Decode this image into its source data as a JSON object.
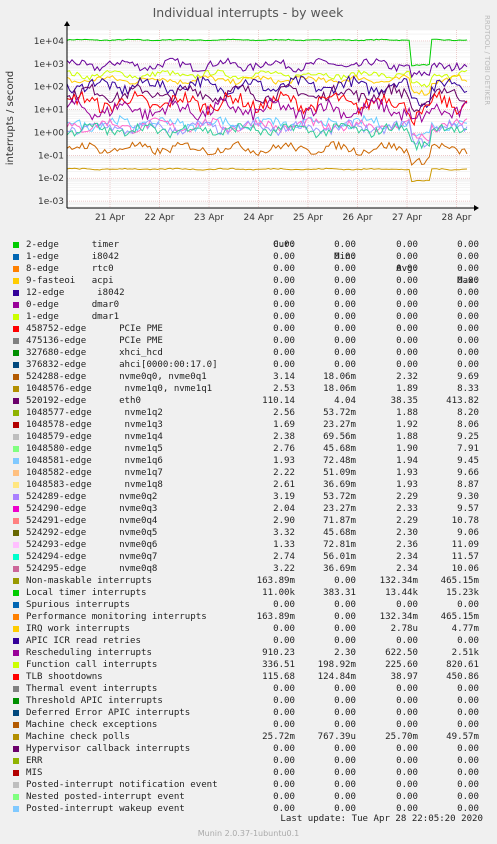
{
  "chart_data": {
    "type": "line",
    "title": "Individual interrupts - by week",
    "ylabel": "interrupts / second",
    "yscale": "log",
    "ylim": [
      0.0005,
      30000
    ],
    "y_ticks": [
      "1e+04",
      "1e+03",
      "1e+02",
      "1e+01",
      "1e+00",
      "1e-01",
      "1e-02",
      "1e-03"
    ],
    "x_ticks": [
      "21 Apr",
      "22 Apr",
      "23 Apr",
      "24 Apr",
      "25 Apr",
      "26 Apr",
      "27 Apr",
      "28 Apr"
    ],
    "side_label": "RRDTOOL / TOBI OETIKER",
    "grid": true,
    "series_profiles": [
      {
        "color": "#00cc00",
        "level": 11000,
        "spread": 0.04,
        "note": "Local timer interrupts"
      },
      {
        "color": "#660099",
        "level": 900,
        "spread": 0.35
      },
      {
        "color": "#ccff00",
        "level": 336,
        "spread": 0.25
      },
      {
        "color": "#ffcc00",
        "level": 200,
        "spread": 0.25
      },
      {
        "color": "#330099",
        "level": 110,
        "spread": 0.5
      },
      {
        "color": "#660066",
        "level": 50,
        "spread": 0.5
      },
      {
        "color": "#ff0000",
        "level": 20,
        "spread": 0.6
      },
      {
        "color": "#990099",
        "level": 10,
        "spread": 0.6
      },
      {
        "color": "#66ccff",
        "level": 2.5,
        "spread": 0.4
      },
      {
        "color": "#ff66cc",
        "level": 2.0,
        "spread": 0.4
      },
      {
        "color": "#9999ff",
        "level": 1.6,
        "spread": 0.4
      },
      {
        "color": "#33cc99",
        "level": 1.3,
        "spread": 0.4
      },
      {
        "color": "#cc6600",
        "level": 0.2,
        "spread": 0.35
      },
      {
        "color": "#cc9900",
        "level": 0.025,
        "spread": 0.05
      }
    ]
  },
  "legend": {
    "headers": {
      "cur": "Cur:",
      "min": "Min:",
      "avg": "Avg:",
      "max": "Max:"
    },
    "rows": [
      {
        "name": "2-edge      timer",
        "color": "#00cc00",
        "cur": "0.00",
        "min": "0.00",
        "avg": "0.00",
        "max": "0.00"
      },
      {
        "name": "1-edge      i8042",
        "color": "#0066b3",
        "cur": "0.00",
        "min": "0.00",
        "avg": "0.00",
        "max": "0.00"
      },
      {
        "name": "8-edge      rtc0",
        "color": "#ff8000",
        "cur": "0.00",
        "min": "0.00",
        "avg": "0.00",
        "max": "0.00"
      },
      {
        "name": "9-fasteoi   acpi",
        "color": "#ffcc00",
        "cur": "0.00",
        "min": "0.00",
        "avg": "0.00",
        "max": "0.00"
      },
      {
        "name": "12-edge      i8042",
        "color": "#330099",
        "cur": "0.00",
        "min": "0.00",
        "avg": "0.00",
        "max": "0.00"
      },
      {
        "name": "0-edge      dmar0",
        "color": "#990099",
        "cur": "0.00",
        "min": "0.00",
        "avg": "0.00",
        "max": "0.00"
      },
      {
        "name": "1-edge      dmar1",
        "color": "#ccff00",
        "cur": "0.00",
        "min": "0.00",
        "avg": "0.00",
        "max": "0.00"
      },
      {
        "name": "458752-edge      PCIe PME",
        "color": "#ff0000",
        "cur": "0.00",
        "min": "0.00",
        "avg": "0.00",
        "max": "0.00"
      },
      {
        "name": "475136-edge      PCIe PME",
        "color": "#808080",
        "cur": "0.00",
        "min": "0.00",
        "avg": "0.00",
        "max": "0.00"
      },
      {
        "name": "327680-edge      xhci_hcd",
        "color": "#008f00",
        "cur": "0.00",
        "min": "0.00",
        "avg": "0.00",
        "max": "0.00"
      },
      {
        "name": "376832-edge      ahci[0000:00:17.0]",
        "color": "#00487d",
        "cur": "0.00",
        "min": "0.00",
        "avg": "0.00",
        "max": "0.00"
      },
      {
        "name": "524288-edge      nvme0q0, nvme0q1",
        "color": "#b35a00",
        "cur": "3.14",
        "min": "18.06m",
        "avg": "2.32",
        "max": "9.69"
      },
      {
        "name": "1048576-edge      nvme1q0, nvme1q1",
        "color": "#b38f00",
        "cur": "2.53",
        "min": "18.06m",
        "avg": "1.89",
        "max": "8.33"
      },
      {
        "name": "520192-edge      eth0",
        "color": "#6b006b",
        "cur": "110.14",
        "min": "4.04",
        "avg": "38.35",
        "max": "413.82"
      },
      {
        "name": "1048577-edge      nvme1q2",
        "color": "#8fb300",
        "cur": "2.56",
        "min": "53.72m",
        "avg": "1.88",
        "max": "8.20"
      },
      {
        "name": "1048578-edge      nvme1q3",
        "color": "#b30000",
        "cur": "1.69",
        "min": "23.27m",
        "avg": "1.92",
        "max": "8.06"
      },
      {
        "name": "1048579-edge      nvme1q4",
        "color": "#bebebe",
        "cur": "2.38",
        "min": "69.56m",
        "avg": "1.88",
        "max": "9.25"
      },
      {
        "name": "1048580-edge      nvme1q5",
        "color": "#80ff80",
        "cur": "2.76",
        "min": "45.68m",
        "avg": "1.90",
        "max": "7.91"
      },
      {
        "name": "1048581-edge      nvme1q6",
        "color": "#80c9ff",
        "cur": "1.93",
        "min": "72.48m",
        "avg": "1.94",
        "max": "9.45"
      },
      {
        "name": "1048582-edge      nvme1q7",
        "color": "#ffc080",
        "cur": "2.22",
        "min": "51.09m",
        "avg": "1.93",
        "max": "9.66"
      },
      {
        "name": "1048583-edge      nvme1q8",
        "color": "#ffe680",
        "cur": "2.61",
        "min": "36.69m",
        "avg": "1.93",
        "max": "8.87"
      },
      {
        "name": "524289-edge      nvme0q2",
        "color": "#aa80ff",
        "cur": "3.19",
        "min": "53.72m",
        "avg": "2.29",
        "max": "9.30"
      },
      {
        "name": "524290-edge      nvme0q3",
        "color": "#ee00cc",
        "cur": "2.04",
        "min": "23.27m",
        "avg": "2.33",
        "max": "9.57"
      },
      {
        "name": "524291-edge      nvme0q4",
        "color": "#ff8080",
        "cur": "2.90",
        "min": "71.87m",
        "avg": "2.29",
        "max": "10.78"
      },
      {
        "name": "524292-edge      nvme0q5",
        "color": "#666600",
        "cur": "3.32",
        "min": "45.68m",
        "avg": "2.30",
        "max": "9.06"
      },
      {
        "name": "524293-edge      nvme0q6",
        "color": "#ffbfff",
        "cur": "1.33",
        "min": "72.81m",
        "avg": "2.36",
        "max": "11.09"
      },
      {
        "name": "524294-edge      nvme0q7",
        "color": "#00ffcc",
        "cur": "2.74",
        "min": "56.01m",
        "avg": "2.34",
        "max": "11.57"
      },
      {
        "name": "524295-edge      nvme0q8",
        "color": "#cc6699",
        "cur": "3.22",
        "min": "36.69m",
        "avg": "2.34",
        "max": "10.06"
      },
      {
        "name": "Non-maskable interrupts",
        "color": "#999900",
        "cur": "163.89m",
        "min": "0.00",
        "avg": "132.34m",
        "max": "465.15m"
      },
      {
        "name": "Local timer interrupts",
        "color": "#00cc00",
        "cur": "11.00k",
        "min": "383.31",
        "avg": "13.44k",
        "max": "15.23k"
      },
      {
        "name": "Spurious interrupts",
        "color": "#0066b3",
        "cur": "0.00",
        "min": "0.00",
        "avg": "0.00",
        "max": "0.00"
      },
      {
        "name": "Performance monitoring interrupts",
        "color": "#ff8000",
        "cur": "163.89m",
        "min": "0.00",
        "avg": "132.34m",
        "max": "465.15m"
      },
      {
        "name": "IRQ work interrupts",
        "color": "#ffcc00",
        "cur": "0.00",
        "min": "0.00",
        "avg": "2.78u",
        "max": "4.77m"
      },
      {
        "name": "APIC ICR read retries",
        "color": "#330099",
        "cur": "0.00",
        "min": "0.00",
        "avg": "0.00",
        "max": "0.00"
      },
      {
        "name": "Rescheduling interrupts",
        "color": "#990099",
        "cur": "910.23",
        "min": "2.30",
        "avg": "622.50",
        "max": "2.51k"
      },
      {
        "name": "Function call interrupts",
        "color": "#ccff00",
        "cur": "336.51",
        "min": "198.92m",
        "avg": "225.60",
        "max": "820.61"
      },
      {
        "name": "TLB shootdowns",
        "color": "#ff0000",
        "cur": "115.68",
        "min": "124.84m",
        "avg": "38.97",
        "max": "450.86"
      },
      {
        "name": "Thermal event interrupts",
        "color": "#808080",
        "cur": "0.00",
        "min": "0.00",
        "avg": "0.00",
        "max": "0.00"
      },
      {
        "name": "Threshold APIC interrupts",
        "color": "#008f00",
        "cur": "0.00",
        "min": "0.00",
        "avg": "0.00",
        "max": "0.00"
      },
      {
        "name": "Deferred Error APIC interrupts",
        "color": "#00487d",
        "cur": "0.00",
        "min": "0.00",
        "avg": "0.00",
        "max": "0.00"
      },
      {
        "name": "Machine check exceptions",
        "color": "#b35a00",
        "cur": "0.00",
        "min": "0.00",
        "avg": "0.00",
        "max": "0.00"
      },
      {
        "name": "Machine check polls",
        "color": "#b38f00",
        "cur": "25.72m",
        "min": "767.39u",
        "avg": "25.70m",
        "max": "49.57m"
      },
      {
        "name": "Hypervisor callback interrupts",
        "color": "#6b006b",
        "cur": "0.00",
        "min": "0.00",
        "avg": "0.00",
        "max": "0.00"
      },
      {
        "name": "ERR",
        "color": "#8fb300",
        "cur": "0.00",
        "min": "0.00",
        "avg": "0.00",
        "max": "0.00"
      },
      {
        "name": "MIS",
        "color": "#b30000",
        "cur": "0.00",
        "min": "0.00",
        "avg": "0.00",
        "max": "0.00"
      },
      {
        "name": "Posted-interrupt notification event",
        "color": "#bebebe",
        "cur": "0.00",
        "min": "0.00",
        "avg": "0.00",
        "max": "0.00"
      },
      {
        "name": "Nested posted-interrupt event",
        "color": "#80ff80",
        "cur": "0.00",
        "min": "0.00",
        "avg": "0.00",
        "max": "0.00"
      },
      {
        "name": "Posted-interrupt wakeup event",
        "color": "#80c9ff",
        "cur": "0.00",
        "min": "0.00",
        "avg": "0.00",
        "max": "0.00"
      }
    ]
  },
  "footer": {
    "last_update": "Last update: Tue Apr 28 22:05:20 2020",
    "version": "Munin 2.0.37-1ubuntu0.1"
  }
}
